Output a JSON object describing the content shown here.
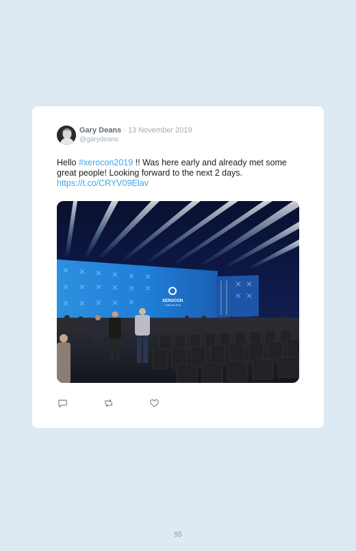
{
  "tweet": {
    "author_name": "Gary Deans",
    "separator": " · ",
    "date": "13 November 2019",
    "handle": "@garydeans",
    "text_before": "Hello ",
    "hashtag": "#xerocon2019",
    "text_after": " !! Was here early and already met some great people! Looking forward to the next 2 days.",
    "url": "https://t.co/CRYV09Elav",
    "photo_logo_line1": "XEROCON",
    "photo_logo_line2": "LONDON 2019"
  },
  "actions": {
    "icons": [
      "reply-icon",
      "retweet-icon",
      "like-icon"
    ]
  },
  "page_number": "55",
  "colors": {
    "page_background": "#ddeaf3",
    "card": "#ffffff",
    "link": "#3fa6e5",
    "muted": "#a2adb8",
    "icon": "#7a8791"
  }
}
